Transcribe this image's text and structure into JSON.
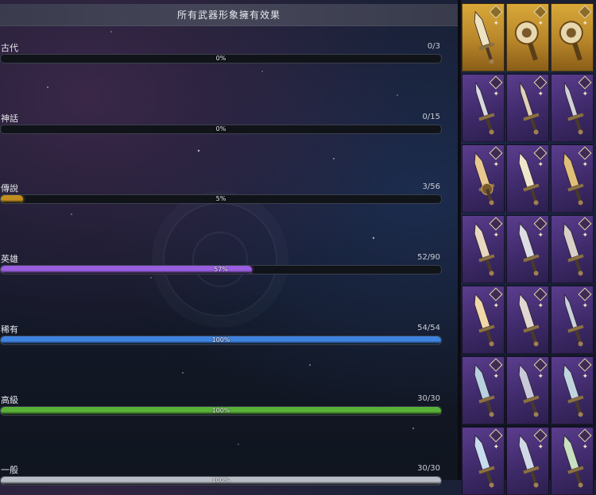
{
  "header": {
    "title": "所有武器形象擁有效果"
  },
  "rows": [
    {
      "label": "古代",
      "count": "0/3",
      "percent": "0%",
      "fill_percent": 0,
      "color": "#c08a2a"
    },
    {
      "label": "神話",
      "count": "0/15",
      "percent": "0%",
      "fill_percent": 0,
      "color": "#c0392b"
    },
    {
      "label": "傳說",
      "count": "3/56",
      "percent": "5%",
      "fill_percent": 5,
      "color": "#c28e1e"
    },
    {
      "label": "英雄",
      "count": "52/90",
      "percent": "57%",
      "fill_percent": 57,
      "color": "#9a5ee0"
    },
    {
      "label": "稀有",
      "count": "54/54",
      "percent": "100%",
      "fill_percent": 100,
      "color": "#3f83e0"
    },
    {
      "label": "高級",
      "count": "30/30",
      "percent": "100%",
      "fill_percent": 100,
      "color": "#59b238"
    },
    {
      "label": "一般",
      "count": "30/30",
      "percent": "100%",
      "fill_percent": 100,
      "color": "#b8bcc4"
    }
  ],
  "weapon_grid": {
    "columns": 3,
    "cells": [
      {
        "rarity": "gold",
        "icon": "sword-icon",
        "blade_color": "#efe2c0"
      },
      {
        "rarity": "gold",
        "icon": "shield-skull-icon",
        "blade_color": "#e8d8b0"
      },
      {
        "rarity": "gold",
        "icon": "shield-emblem-icon",
        "blade_color": "#e8d8b0"
      },
      {
        "rarity": "purple",
        "icon": "spear-icon",
        "blade_color": "#d8d8e0"
      },
      {
        "rarity": "purple",
        "icon": "spear-icon",
        "blade_color": "#e0d0b8"
      },
      {
        "rarity": "purple",
        "icon": "spear-icon",
        "blade_color": "#d0d0d8"
      },
      {
        "rarity": "purple",
        "icon": "round-guard-sword-icon",
        "blade_color": "#e8c890"
      },
      {
        "rarity": "purple",
        "icon": "sword-icon",
        "blade_color": "#f0e6cc"
      },
      {
        "rarity": "purple",
        "icon": "ornate-sword-icon",
        "blade_color": "#e0c078"
      },
      {
        "rarity": "purple",
        "icon": "sword-icon",
        "blade_color": "#e8d8c0"
      },
      {
        "rarity": "purple",
        "icon": "sword-icon",
        "blade_color": "#dcdce4"
      },
      {
        "rarity": "purple",
        "icon": "ornate-sword-icon",
        "blade_color": "#d8d0c8"
      },
      {
        "rarity": "purple",
        "icon": "sword-icon",
        "blade_color": "#f0d8a8"
      },
      {
        "rarity": "purple",
        "icon": "sword-icon",
        "blade_color": "#e0d8d0"
      },
      {
        "rarity": "purple",
        "icon": "spear-icon",
        "blade_color": "#c8d0dc"
      },
      {
        "rarity": "purple",
        "icon": "scimitar-icon",
        "blade_color": "#b8d0e0"
      },
      {
        "rarity": "purple",
        "icon": "sword-icon",
        "blade_color": "#c8c8d8"
      },
      {
        "rarity": "purple",
        "icon": "scimitar-icon",
        "blade_color": "#c0d4e0"
      },
      {
        "rarity": "purple",
        "icon": "sword-icon",
        "blade_color": "#c8dcf0"
      },
      {
        "rarity": "purple",
        "icon": "sword-icon",
        "blade_color": "#d0d8e8"
      },
      {
        "rarity": "purple",
        "icon": "sword-icon",
        "blade_color": "#c8e0c0"
      }
    ]
  }
}
